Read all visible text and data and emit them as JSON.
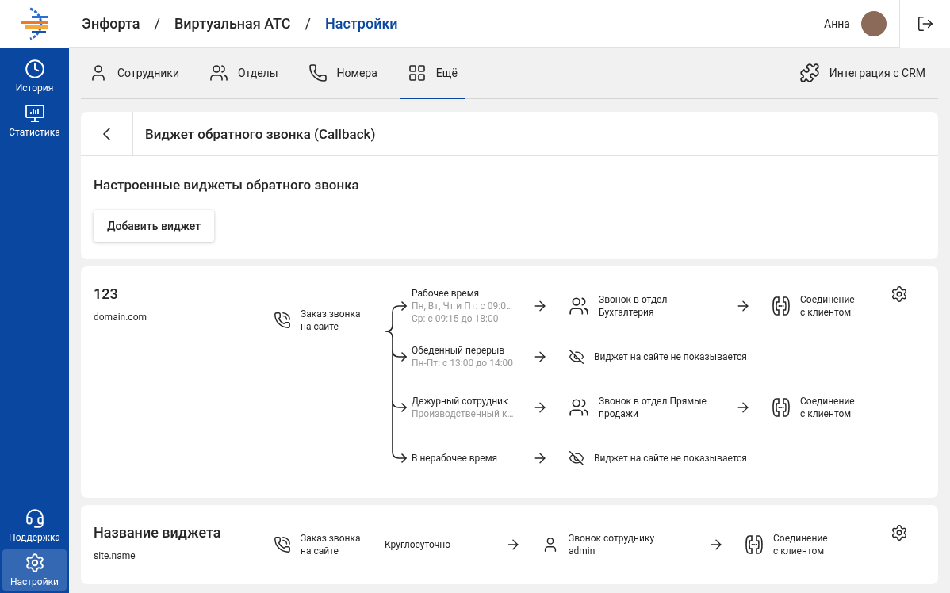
{
  "breadcrumbs": [
    {
      "label": "Энфорта",
      "selected": false
    },
    {
      "separator": "/",
      "label": "Виртуальная АТС",
      "selected": false
    },
    {
      "separator": "/",
      "label": "Настройки",
      "selected": true
    }
  ],
  "user": {
    "name": "Анна"
  },
  "sidebar": {
    "top_items": [
      {
        "label": "История",
        "selected": false
      },
      {
        "label": "Статистика",
        "selected": false
      }
    ],
    "bottom_items": [
      {
        "label": "Поддержка",
        "selected": false
      },
      {
        "label": "Настройки",
        "selected": true
      }
    ]
  },
  "tabs": [
    {
      "label": "Сотрудники",
      "selected": false
    },
    {
      "label": "Отделы",
      "selected": false
    },
    {
      "label": "Номера",
      "selected": false
    },
    {
      "label": "Ещё",
      "selected": true
    }
  ],
  "crm_link": "Интеграция с CRM",
  "page": {
    "title": "Виджет обратного звонка (Callback)",
    "section_title": "Настроенные виджеты обратного звонка",
    "add_button": "Добавить виджет"
  },
  "widgets": [
    {
      "name": "123",
      "domain": "domain.com",
      "source": "Заказ звонка\nна сайте",
      "branches": [
        {
          "condition": "Рабочее время",
          "details": [
            "Пн, Вт, Чт и Пт: с 09:0…",
            "Ср: с 09:15 до 18:00"
          ],
          "target": {
            "kind": "department",
            "text": "Звонок в отдел\nБухгалтерия"
          },
          "final": "Соединение\nс клиентом"
        },
        {
          "condition": "Обеденный перерыв",
          "details": [
            "Пн-Пт: с 13:00 до 14:00"
          ],
          "target": {
            "kind": "hidden",
            "text": "Виджет на сайте не показывается"
          }
        },
        {
          "condition": "Дежурный сотрудник",
          "details": [
            "Производственный к…"
          ],
          "target": {
            "kind": "department",
            "text": "Звонок в отдел Прямые\nпродажи"
          },
          "final": "Соединение\nс клиентом"
        },
        {
          "condition": "В нерабочее время",
          "target": {
            "kind": "hidden",
            "text": "Виджет на сайте не показывается"
          }
        }
      ]
    },
    {
      "name": "Название виджета",
      "domain": "site.name",
      "source": "Заказ звонка\nна сайте",
      "branches": [
        {
          "condition": "Круглосуточно",
          "target": {
            "kind": "employee",
            "text": "Звонок сотруднику\nadmin"
          },
          "final": "Соединение\nс клиентом"
        }
      ]
    }
  ]
}
